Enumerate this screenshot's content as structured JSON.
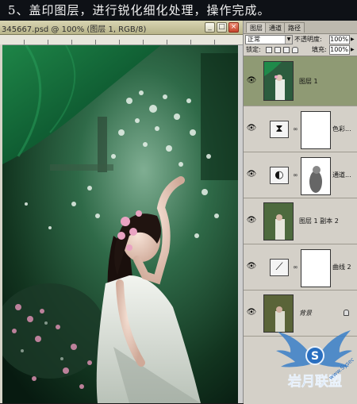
{
  "banner": {
    "text": "5、盖印图层，进行锐化细化处理，操作完成。"
  },
  "document": {
    "title": "345667.psd @ 100% (图层 1, RGB/8)",
    "buttons": {
      "minimize": "_",
      "maximize": "□",
      "close": "×"
    }
  },
  "panel": {
    "tabs": [
      "图层",
      "通道",
      "路径"
    ],
    "blend_mode": "正常",
    "opacity_label": "不透明度:",
    "opacity_value": "100%",
    "lock_label": "锁定:",
    "fill_label": "填充:",
    "fill_value": "100%",
    "layers": [
      {
        "name": "图层 1",
        "type": "photo",
        "selected": true
      },
      {
        "name": "色彩...",
        "type": "adjustment",
        "icon": "hue-saturation-icon"
      },
      {
        "name": "通道...",
        "type": "adjustment",
        "icon": "channel-mixer-icon"
      },
      {
        "name": "图层 1 副本 2",
        "type": "photo"
      },
      {
        "name": "曲线 2",
        "type": "adjustment",
        "icon": "curves-icon"
      },
      {
        "name": "背景",
        "type": "photo",
        "locked": true
      }
    ]
  },
  "watermark": {
    "text": "岩月联盟",
    "sub": "www.Sysec"
  },
  "colors": {
    "selected_layer": "#8f9a74",
    "panel_bg": "#d4d0c8",
    "canvas_green": "#0f3d22"
  }
}
